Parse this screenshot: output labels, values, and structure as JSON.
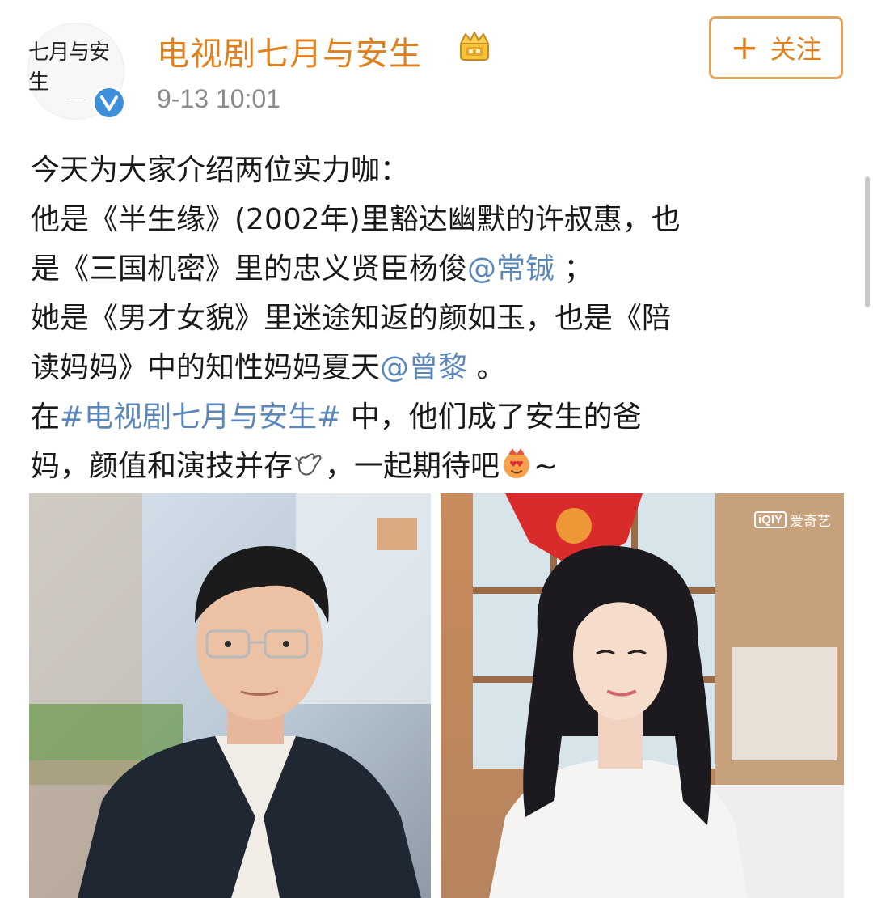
{
  "account": {
    "name": "电视剧七月与安生",
    "avatar_text": "七月与安生",
    "timestamp": "9-13 10:01"
  },
  "follow_button": {
    "plus": "+",
    "label": "关注"
  },
  "post": {
    "line1": "今天为大家介绍两位实力咖：",
    "line2": "他是《半生缘》(2002年)里豁达幽默的许叔惠，也",
    "line3_a": "是《三国机密》里的忠义贤臣杨俊",
    "line3_mention": "@常铖",
    "line3_b": " ；",
    "line4": "她是《男才女貌》里迷途知返的颜如玉，也是《陪",
    "line5_a": "读妈妈》中的知性妈妈夏天",
    "line5_mention": "@曾黎",
    "line5_b": " 。",
    "line6_a": "在",
    "line6_hashtag": "#电视剧七月与安生#",
    "line6_b": " 中，他们成了安生的爸",
    "line7_a": "妈，颜值和演技并存",
    "line7_b": "，一起期待吧",
    "line7_c": "~"
  },
  "photos": {
    "watermark_logo": "iQIY",
    "watermark_text": "爱奇艺"
  },
  "icons": {
    "verified": "verified-v-icon",
    "crown": "crown-badge-icon",
    "emoji1": "hang-loose-hand-emoji",
    "emoji2": "heart-eyes-emoji"
  },
  "colors": {
    "accent": "#e0801d",
    "link": "#5b87b9",
    "verified": "#3d8edb"
  }
}
